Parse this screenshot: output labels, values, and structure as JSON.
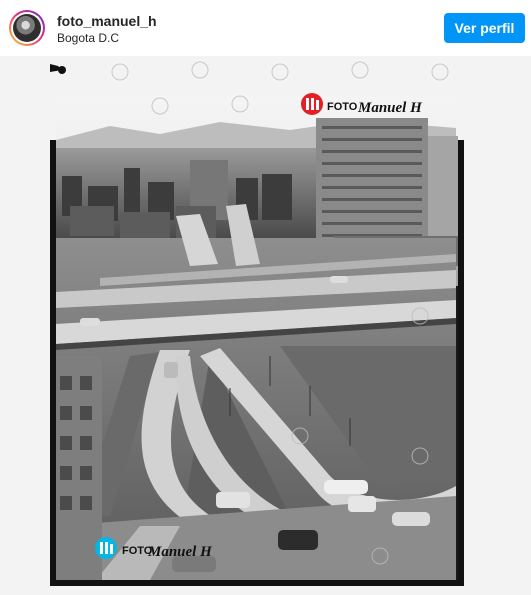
{
  "post": {
    "username": "foto_manuel_h",
    "location": "Bogota D.C",
    "profile_button": "Ver perfil"
  },
  "photo": {
    "watermark_text": "FOTO Manuel H",
    "brand_red": "#e21f26",
    "brand_cyan": "#00b7e6"
  }
}
